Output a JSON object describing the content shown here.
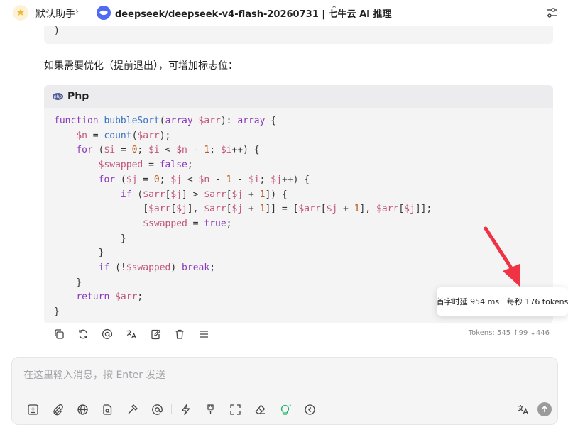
{
  "header": {
    "assistant_name": "默认助手",
    "model_name": "deepseek/deepseek-v4-flash-20260731 | 七牛云 AI 推理"
  },
  "prev_code": {
    "tail": ")"
  },
  "message": {
    "paragraph": "如果需要优化（提前退出），可增加标志位：",
    "code_lang": "Php",
    "code_lines": [
      "function bubbleSort(array $arr): array {",
      "    $n = count($arr);",
      "    for ($i = 0; $i < $n - 1; $i++) {",
      "        $swapped = false;",
      "        for ($j = 0; $j < $n - 1 - $i; $j++) {",
      "            if ($arr[$j] > $arr[$j + 1]) {",
      "                [$arr[$j], $arr[$j + 1]] = [$arr[$j + 1], $arr[$j]];",
      "                $swapped = true;",
      "            }",
      "        }",
      "        if (!$swapped) break;",
      "    }",
      "    return $arr;",
      "}"
    ],
    "token_info": "Tokens: 545 ↑99 ↓446"
  },
  "tooltip": {
    "text": "首字时延 954 ms | 每秒 176 tokens"
  },
  "input": {
    "placeholder": "在这里输入消息，按 Enter 发送"
  },
  "colors": {
    "accent_red": "#ef3345",
    "model_icon": "#4e6bf2",
    "tip_icon": "#1fb26a"
  }
}
